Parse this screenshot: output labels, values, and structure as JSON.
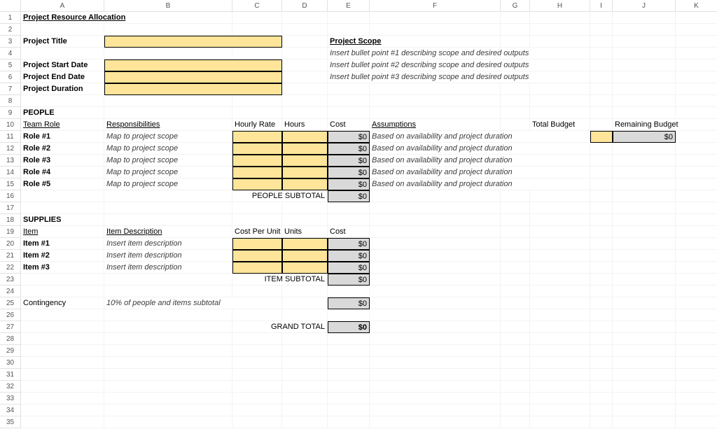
{
  "columns": [
    "",
    "A",
    "B",
    "C",
    "D",
    "E",
    "F",
    "G",
    "H",
    "I",
    "J",
    "K"
  ],
  "title": "Project Resource Allocation",
  "labels": {
    "project_title": "Project Title",
    "project_start": "Project Start Date",
    "project_end": "Project End Date",
    "project_duration": "Project Duration",
    "project_scope": "Project Scope",
    "scope_bullet1": "Insert bullet point #1 describing scope and desired outputs",
    "scope_bullet2": "Insert bullet point #2 describing scope and desired outputs",
    "scope_bullet3": "Insert bullet point #3 describing scope and desired outputs",
    "people": "PEOPLE",
    "team_role": "Team Role",
    "responsibilities": "Responsibilities",
    "hourly_rate": "Hourly Rate",
    "hours": "Hours",
    "cost": "Cost",
    "assumptions": "Assumptions",
    "total_budget": "Total Budget",
    "remaining_budget": "Remaining Budget",
    "people_subtotal": "PEOPLE SUBTOTAL",
    "supplies": "SUPPLIES",
    "item": "Item",
    "item_desc": "Item Description",
    "cpu": "Cost Per Unit",
    "units": "Units",
    "item_subtotal": "ITEM SUBTOTAL",
    "contingency": "Contingency",
    "contingency_desc": "10% of people and items subtotal",
    "grand_total": "GRAND TOTAL"
  },
  "roles": [
    {
      "name": "Role #1",
      "resp": "Map to project scope",
      "cost": "$0",
      "assump": "Based on availability and project duration"
    },
    {
      "name": "Role #2",
      "resp": "Map to project scope",
      "cost": "$0",
      "assump": "Based on availability and project duration"
    },
    {
      "name": "Role #3",
      "resp": "Map to project scope",
      "cost": "$0",
      "assump": "Based on availability and project duration"
    },
    {
      "name": "Role #4",
      "resp": "Map to project scope",
      "cost": "$0",
      "assump": "Based on availability and project duration"
    },
    {
      "name": "Role #5",
      "resp": "Map to project scope",
      "cost": "$0",
      "assump": "Based on availability and project duration"
    }
  ],
  "items": [
    {
      "name": "Item #1",
      "desc": "Insert item description",
      "cost": "$0"
    },
    {
      "name": "Item #2",
      "desc": "Insert item description",
      "cost": "$0"
    },
    {
      "name": "Item #3",
      "desc": "Insert item description",
      "cost": "$0"
    }
  ],
  "values": {
    "people_subtotal": "$0",
    "item_subtotal": "$0",
    "contingency": "$0",
    "grand_total": "$0",
    "remaining_budget": "$0"
  }
}
